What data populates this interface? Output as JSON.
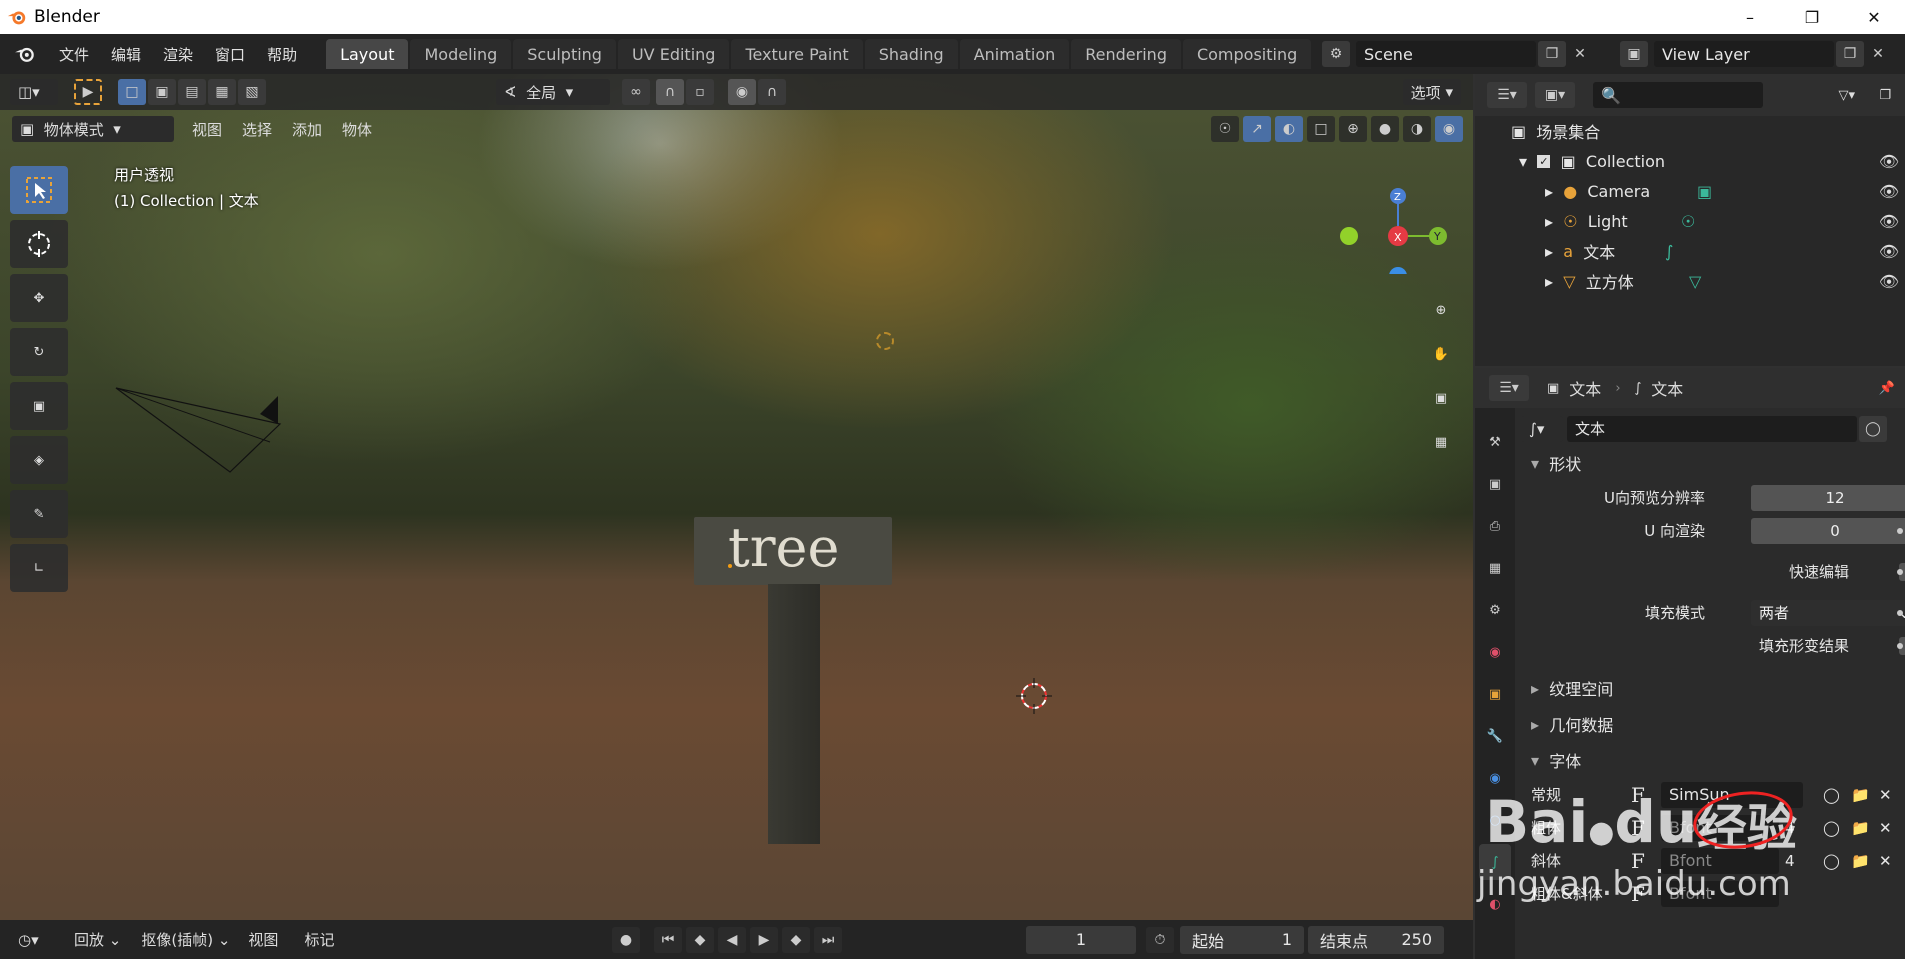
{
  "window": {
    "title": "Blender",
    "controls": [
      "minimize",
      "restore",
      "close"
    ]
  },
  "topbar": {
    "menus": [
      "文件",
      "编辑",
      "渲染",
      "窗口",
      "帮助"
    ],
    "workspaces": [
      "Layout",
      "Modeling",
      "Sculpting",
      "UV Editing",
      "Texture Paint",
      "Shading",
      "Animation",
      "Rendering",
      "Compositing"
    ],
    "active_workspace": "Layout",
    "scene": "Scene",
    "view_layer": "View Layer"
  },
  "viewport": {
    "header": {
      "orientation": "全局",
      "options": "选项"
    },
    "header2": {
      "mode": "物体模式",
      "menus": [
        "视图",
        "选择",
        "添加",
        "物体"
      ]
    },
    "overlay_title": "用户透视",
    "overlay_sub": "(1) Collection | 文本",
    "sign_text": "tree",
    "gizmo": {
      "z": "Z",
      "x": "X",
      "y": "Y"
    }
  },
  "outliner": {
    "root": "场景集合",
    "items": [
      {
        "name": "Collection",
        "icon": "collection-icon"
      },
      {
        "name": "Camera",
        "icon": "camera-icon"
      },
      {
        "name": "Light",
        "icon": "light-icon"
      },
      {
        "name": "文本",
        "icon": "text-icon"
      },
      {
        "name": "立方体",
        "icon": "mesh-icon"
      }
    ]
  },
  "properties": {
    "breadcrumb": [
      "文本",
      "文本"
    ],
    "datablock": "文本",
    "section_shape": "形状",
    "u_preview_label": "U向预览分辨率",
    "u_preview_value": "12",
    "u_render_label": "U 向渲染",
    "u_render_value": "0",
    "fast_edit_label": "快速编辑",
    "fill_mode_label": "填充模式",
    "fill_mode_value": "两者",
    "fill_deform_label": "填充形变结果",
    "sections": [
      "纹理空间",
      "几何数据",
      "字体"
    ],
    "fonts": [
      {
        "label": "常规",
        "value": "SimSun",
        "num": ""
      },
      {
        "label": "粗体",
        "value": "Bfont",
        "num": "4"
      },
      {
        "label": "斜体",
        "value": "Bfont",
        "num": "4"
      },
      {
        "label": "粗体&斜体",
        "value": "Bfont",
        "num": ""
      }
    ]
  },
  "timeline": {
    "playback": "回放",
    "keying": "抠像(插帧)",
    "view": "视图",
    "marker": "标记",
    "current_frame": "1",
    "start_label": "起始",
    "start_value": "1",
    "end_label": "结束点",
    "end_value": "250"
  },
  "watermark": {
    "brand": "Bai",
    "brand2": "du",
    "label": "经验",
    "url": "jingyan.baidu.com"
  }
}
